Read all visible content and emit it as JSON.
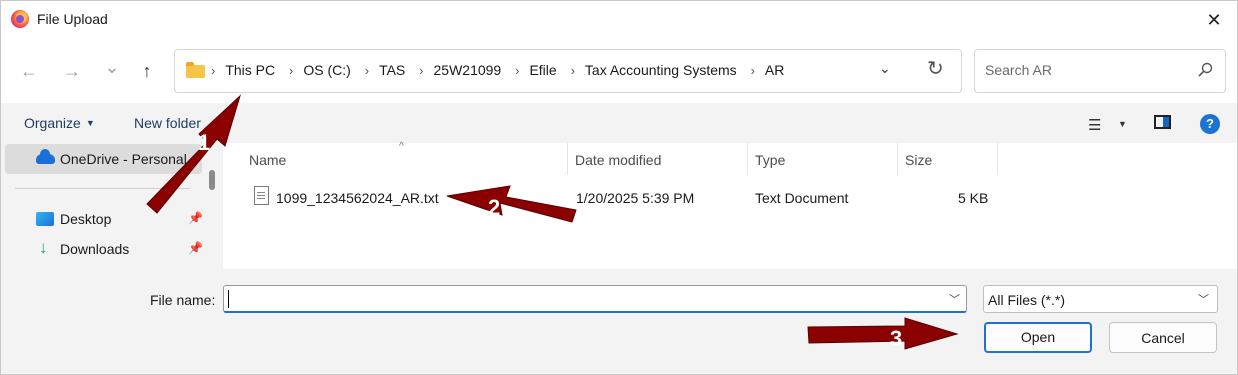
{
  "window": {
    "title": "File Upload",
    "close": "✕"
  },
  "nav": {
    "back": "←",
    "forward": "→",
    "recent": "⌄",
    "up": "↑",
    "breadcrumb": [
      "This PC",
      "OS (C:)",
      "TAS",
      "25W21099",
      "Efile",
      "Tax Accounting Systems",
      "AR"
    ],
    "separator": "›",
    "search_placeholder": "Search AR"
  },
  "toolbar": {
    "organize": "Organize",
    "new_folder": "New folder"
  },
  "sidebar": {
    "items": [
      {
        "label": "OneDrive - Personal",
        "icon": "onedrive-icon",
        "selected": true
      },
      {
        "label": "Desktop",
        "icon": "desktop-icon",
        "pinned": true
      },
      {
        "label": "Downloads",
        "icon": "downloads-icon",
        "pinned": true
      }
    ]
  },
  "files": {
    "columns": [
      "Name",
      "Date modified",
      "Type",
      "Size"
    ],
    "rows": [
      {
        "name": "1099_1234562024_AR.txt",
        "date": "1/20/2025 5:39 PM",
        "type": "Text Document",
        "size": "5 KB"
      }
    ]
  },
  "footer": {
    "filename_label": "File name:",
    "filename_value": "",
    "filetype": "All Files (*.*)",
    "open": "Open",
    "cancel": "Cancel"
  },
  "annotations": {
    "arrow1": "1",
    "arrow2": "2",
    "arrow3": "3",
    "color": "#8b0000"
  }
}
